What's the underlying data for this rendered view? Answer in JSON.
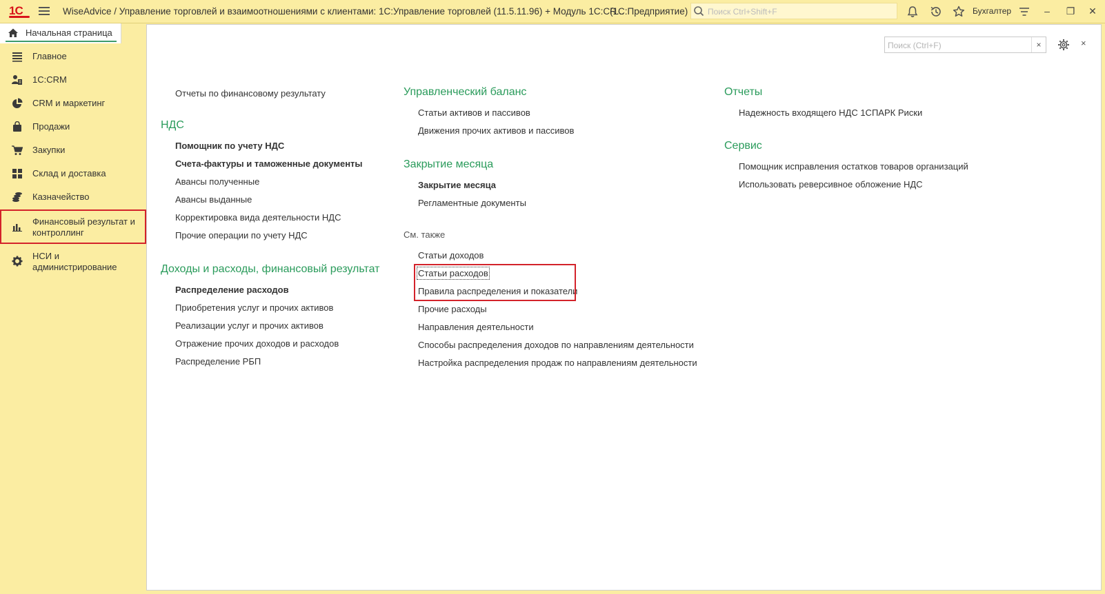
{
  "titlebar": {
    "logo_text": "1С",
    "title": "WiseAdvice / Управление торговлей и взаимоотношениями с клиентами: 1С:Управление торговлей (11.5.11.96) + Модуль 1С:CR...",
    "mode": "(1С:Предприятие)",
    "search_placeholder": "Поиск Ctrl+Shift+F",
    "user": "Бухгалтер",
    "icons": [
      "bell-icon",
      "history-icon",
      "star-icon",
      "menu-settings-icon"
    ],
    "window_buttons": {
      "minimize": "–",
      "restore": "❐",
      "close": "✕"
    }
  },
  "home_tab": {
    "label": "Начальная страница",
    "icon": "home-icon"
  },
  "sidebar": {
    "items": [
      {
        "label": "Главное",
        "icon": "list-icon"
      },
      {
        "label": "1С:CRM",
        "icon": "crm-users-icon"
      },
      {
        "label": "CRM и маркетинг",
        "icon": "pie-chart-icon"
      },
      {
        "label": "Продажи",
        "icon": "shopping-bag-icon"
      },
      {
        "label": "Закупки",
        "icon": "shopping-cart-icon"
      },
      {
        "label": "Склад и доставка",
        "icon": "warehouse-grid-icon"
      },
      {
        "label": "Казначейство",
        "icon": "coins-icon"
      },
      {
        "label": "Финансовый результат и контроллинг",
        "icon": "bar-chart-icon",
        "active": true
      },
      {
        "label": "НСИ и администрирование",
        "icon": "gear-icon"
      }
    ]
  },
  "main": {
    "search_placeholder": "Поиск (Ctrl+F)",
    "clear_label": "×",
    "close_label": "×",
    "col1": {
      "top_link": "Отчеты по финансовому результату",
      "vat": {
        "title": "НДС",
        "links": [
          {
            "label": "Помощник по учету НДС",
            "bold": true
          },
          {
            "label": "Счета-фактуры и таможенные документы",
            "bold": true
          },
          {
            "label": "Авансы полученные",
            "bold": false
          },
          {
            "label": "Авансы выданные",
            "bold": false
          },
          {
            "label": "Корректировка вида деятельности НДС",
            "bold": false
          },
          {
            "label": "Прочие операции по учету НДС",
            "bold": false
          }
        ]
      },
      "income": {
        "title": "Доходы и расходы, финансовый результат",
        "links": [
          {
            "label": "Распределение расходов",
            "bold": true
          },
          {
            "label": "Приобретения услуг и прочих активов",
            "bold": false
          },
          {
            "label": "Реализации услуг и прочих активов",
            "bold": false
          },
          {
            "label": "Отражение прочих доходов и расходов",
            "bold": false
          },
          {
            "label": "Распределение РБП",
            "bold": false
          }
        ]
      }
    },
    "col2": {
      "balance": {
        "title": "Управленческий баланс",
        "links": [
          "Статьи активов и пассивов",
          "Движения прочих активов и пассивов"
        ]
      },
      "closing": {
        "title": "Закрытие месяца",
        "links": [
          {
            "label": "Закрытие месяца",
            "bold": true
          },
          {
            "label": "Регламентные документы",
            "bold": false
          }
        ]
      },
      "see_also": {
        "title": "См. также",
        "links": [
          "Статьи доходов",
          "Статьи расходов",
          "Правила распределения и показатели",
          "Прочие расходы",
          "Направления деятельности",
          "Способы распределения доходов по направлениям деятельности",
          "Настройка распределения продаж по направлениям деятельности"
        ]
      }
    },
    "col3": {
      "reports": {
        "title": "Отчеты",
        "links": [
          "Надежность входящего НДС 1СПАРК Риски"
        ]
      },
      "service": {
        "title": "Сервис",
        "links": [
          "Помощник исправления остатков товаров организаций",
          "Использовать реверсивное обложение НДС"
        ]
      }
    }
  },
  "colors": {
    "accent_green": "#2a9b5b",
    "sidebar_bg": "#fbeda2",
    "highlight_red": "#d3222a"
  }
}
